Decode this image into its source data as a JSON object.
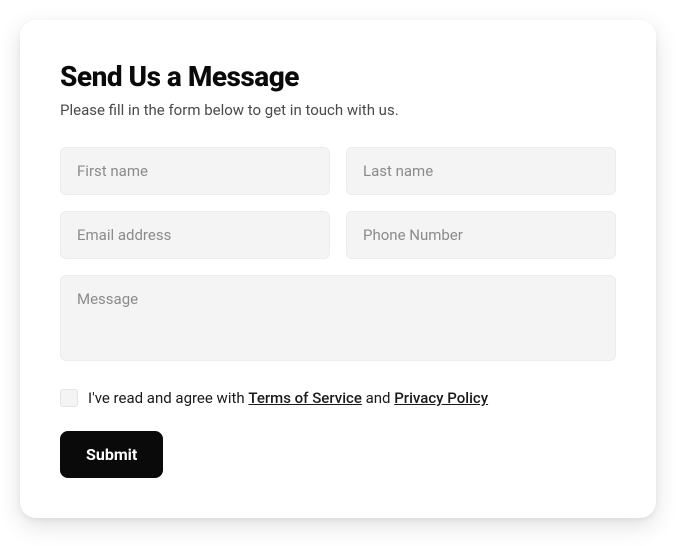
{
  "form": {
    "title": "Send Us a Message",
    "subtitle": "Please fill in the form below to get in touch with us.",
    "fields": {
      "first_name": {
        "placeholder": "First name",
        "value": ""
      },
      "last_name": {
        "placeholder": "Last name",
        "value": ""
      },
      "email": {
        "placeholder": "Email address",
        "value": ""
      },
      "phone": {
        "placeholder": "Phone Number",
        "value": ""
      },
      "message": {
        "placeholder": "Message",
        "value": ""
      }
    },
    "consent": {
      "checked": false,
      "prefix": "I've read and agree with ",
      "tos_label": "Terms of Service",
      "mid": " and ",
      "privacy_label": "Privacy Policy"
    },
    "submit_label": "Submit"
  },
  "colors": {
    "card_bg": "#ffffff",
    "input_bg": "#f4f4f4",
    "input_border": "#ececec",
    "placeholder": "#8b8b8b",
    "text_primary": "#0a0a0a",
    "text_secondary": "#4a4a4a",
    "button_bg": "#0a0a0a",
    "button_text": "#ffffff"
  }
}
